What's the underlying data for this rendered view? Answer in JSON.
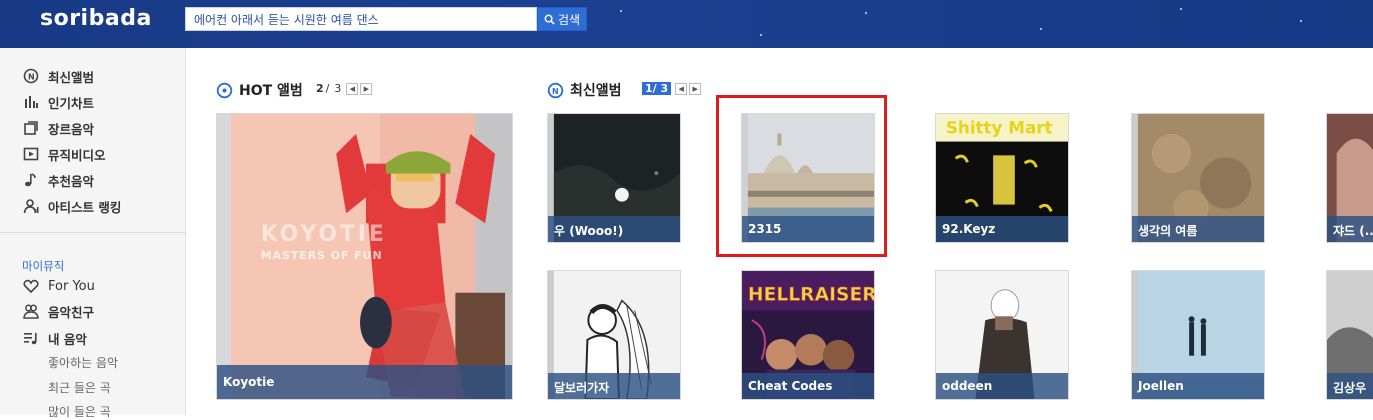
{
  "header": {
    "logo": "soribada",
    "search_value": "에어컨 아래서 듣는 시원한 여름 댄스",
    "search_button": "검색"
  },
  "sidebar": {
    "items": [
      {
        "label": "최신앨범",
        "icon": "new-album-icon"
      },
      {
        "label": "인기차트",
        "icon": "chart-icon"
      },
      {
        "label": "장르음악",
        "icon": "genre-icon"
      },
      {
        "label": "뮤직비디오",
        "icon": "video-play-icon"
      },
      {
        "label": "추천음악",
        "icon": "music-note-icon"
      },
      {
        "label": "아티스트 랭킹",
        "icon": "artist-ranking-icon"
      }
    ],
    "mymusic_title": "마이뮤직",
    "mymusic_items": [
      {
        "label": "For You",
        "icon": "heart-icon"
      },
      {
        "label": "음악친구",
        "icon": "friends-icon"
      },
      {
        "label": "내 음악",
        "icon": "playlist-icon"
      }
    ],
    "sub_items": [
      "좋아하는 음악",
      "최근 들은 곡",
      "많이 들은 곡"
    ]
  },
  "hot": {
    "title": "HOT 앨범",
    "page": "2",
    "sep": "/",
    "total": "3",
    "album": {
      "caption": "Koyotie",
      "art_text_1": "KOYOTIE",
      "art_text_2": "MASTERS OF FUN"
    }
  },
  "latest": {
    "title": "최신앨범",
    "page": "1",
    "sep": "/",
    "total": "3",
    "albums": [
      {
        "caption": "우 (Wooo!)"
      },
      {
        "caption": "2315"
      },
      {
        "caption": "92.Keyz",
        "art_text": "Shitty Mart"
      },
      {
        "caption": "생각의 여름"
      },
      {
        "caption": "쟈드 (..."
      },
      {
        "caption": "달보러가자"
      },
      {
        "caption": "Cheat Codes",
        "art_text": "HELLRAISERS"
      },
      {
        "caption": "oddeen"
      },
      {
        "caption": "Joellen"
      },
      {
        "caption": "김상우"
      }
    ]
  },
  "colors": {
    "header_bg": "#1c3f8f",
    "accent": "#2e6cd6",
    "highlight": "#e01b1b",
    "caption_bg": "#2d5082"
  }
}
